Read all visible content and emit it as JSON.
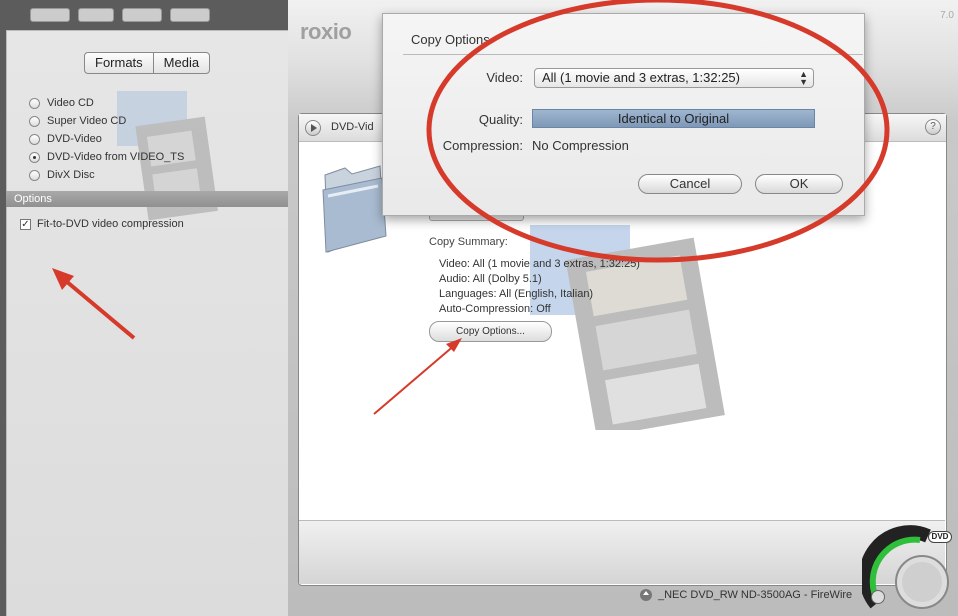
{
  "app": {
    "logo": "roxio",
    "version": "7.0"
  },
  "sidebar": {
    "tabs": [
      "Formats",
      "Media"
    ],
    "formats": [
      {
        "label": "Video CD",
        "selected": false
      },
      {
        "label": "Super Video CD",
        "selected": false
      },
      {
        "label": "DVD-Video",
        "selected": false
      },
      {
        "label": "DVD-Video from VIDEO_TS",
        "selected": true
      },
      {
        "label": "DivX Disc",
        "selected": false
      }
    ],
    "options_header": "Options",
    "fit_to_dvd": {
      "label": "Fit-to-DVD video compression",
      "checked": true
    }
  },
  "inner_window": {
    "title": "DVD-Vid",
    "help_label": "?",
    "copy_summary_label": "Copy Summary:",
    "summary": {
      "video": "Video: All (1 movie and 3 extras, 1:32:25)",
      "audio": "Audio: All (Dolby 5.1)",
      "languages": "Languages: All (English, Italian)",
      "auto_compression": "Auto-Compression: Off"
    },
    "copy_options_button": "Copy Options..."
  },
  "bottom": {
    "drive": "_NEC DVD_RW ND-3500AG - FireWire",
    "dvd_badge": "DVD"
  },
  "dialog": {
    "title": "Copy Options",
    "video_label": "Video:",
    "video_value": "All (1 movie and 3 extras, 1:32:25)",
    "quality_label": "Quality:",
    "quality_value": "Identical to Original",
    "compression_label": "Compression:",
    "compression_value": "No Compression",
    "cancel_label": "Cancel",
    "ok_label": "OK"
  },
  "annotation_colors": {
    "ring": "#d63a2a",
    "arrow": "#d63a2a"
  }
}
